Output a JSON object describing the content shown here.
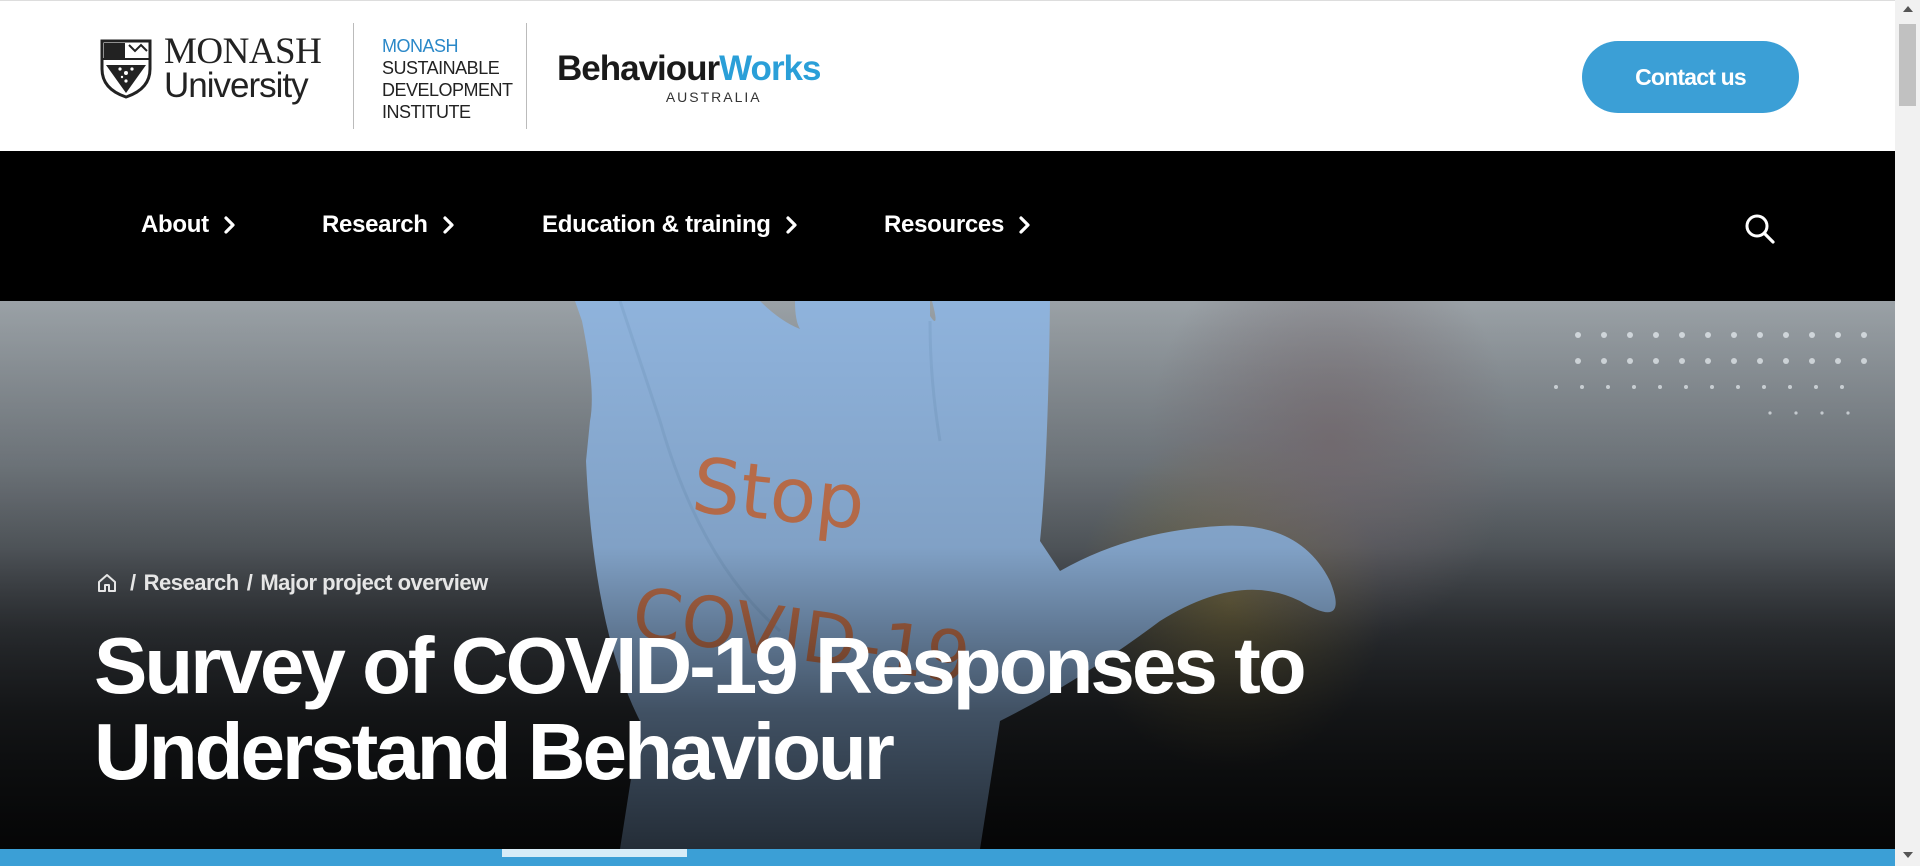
{
  "header": {
    "monash_line1": "MONASH",
    "monash_line2": "University",
    "msdi": [
      "MONASH",
      "SUSTAINABLE",
      "DEVELOPMENT",
      "INSTITUTE"
    ],
    "bworks_part1": "Behaviour",
    "bworks_part2": "Works",
    "bworks_sub": "AUSTRALIA",
    "contact_label": "Contact us",
    "accent_color": "#3b9fd6"
  },
  "nav": {
    "items": [
      {
        "label": "About",
        "icon": "chevron-right-icon"
      },
      {
        "label": "Research",
        "icon": "chevron-right-icon"
      },
      {
        "label": "Education & training",
        "icon": "chevron-right-icon"
      },
      {
        "label": "Resources",
        "icon": "chevron-right-icon"
      }
    ],
    "search_icon": "search-icon"
  },
  "hero": {
    "breadcrumb": [
      {
        "icon": "home-icon"
      },
      {
        "label": "Research"
      },
      {
        "label": "Major project overview"
      }
    ],
    "title": "Survey of COVID-19 Responses to Understand Behaviour",
    "image_handwriting": [
      "Stop",
      "COVID-19"
    ]
  }
}
